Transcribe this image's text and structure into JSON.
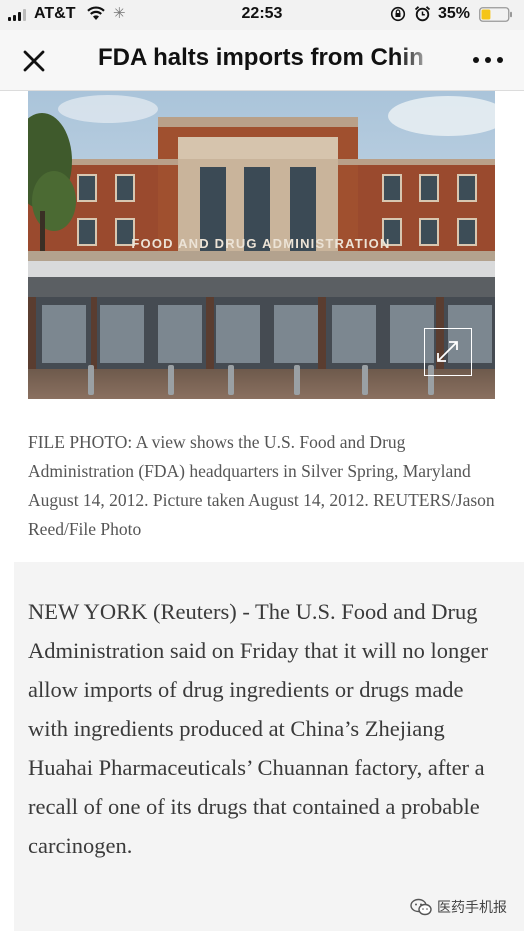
{
  "status_bar": {
    "carrier": "AT&T",
    "time": "22:53",
    "battery_percent": "35%",
    "battery_level": 0.35,
    "battery_color": "#f5c518",
    "icons": [
      "signal-icon",
      "wifi-icon",
      "loading-icon",
      "rotation-lock-icon",
      "alarm-icon",
      "battery-icon"
    ]
  },
  "nav": {
    "title": "FDA halts imports from Chin",
    "close_icon": "close-icon",
    "more_icon": "more-icon"
  },
  "photo": {
    "sign_text": "FOOD AND DRUG ADMINISTRATION",
    "expand_icon": "expand-icon"
  },
  "caption": "FILE PHOTO: A view shows the U.S. Food and Drug Administration (FDA) headquarters in Silver Spring, Maryland August 14, 2012. Picture taken August 14, 2012. REUTERS/Jason Reed/File Photo",
  "article": {
    "body": "NEW YORK (Reuters) - The U.S. Food and Drug Administration said on Friday that it will no longer allow imports of drug ingredients or drugs made with ingredients produced at China’s Zhejiang Huahai Pharmaceuticals’ Chuannan factory, after a recall of one of its drugs that contained a probable carcinogen."
  },
  "watermark": {
    "text": "医药手机报",
    "icon": "wechat-logo-icon"
  }
}
